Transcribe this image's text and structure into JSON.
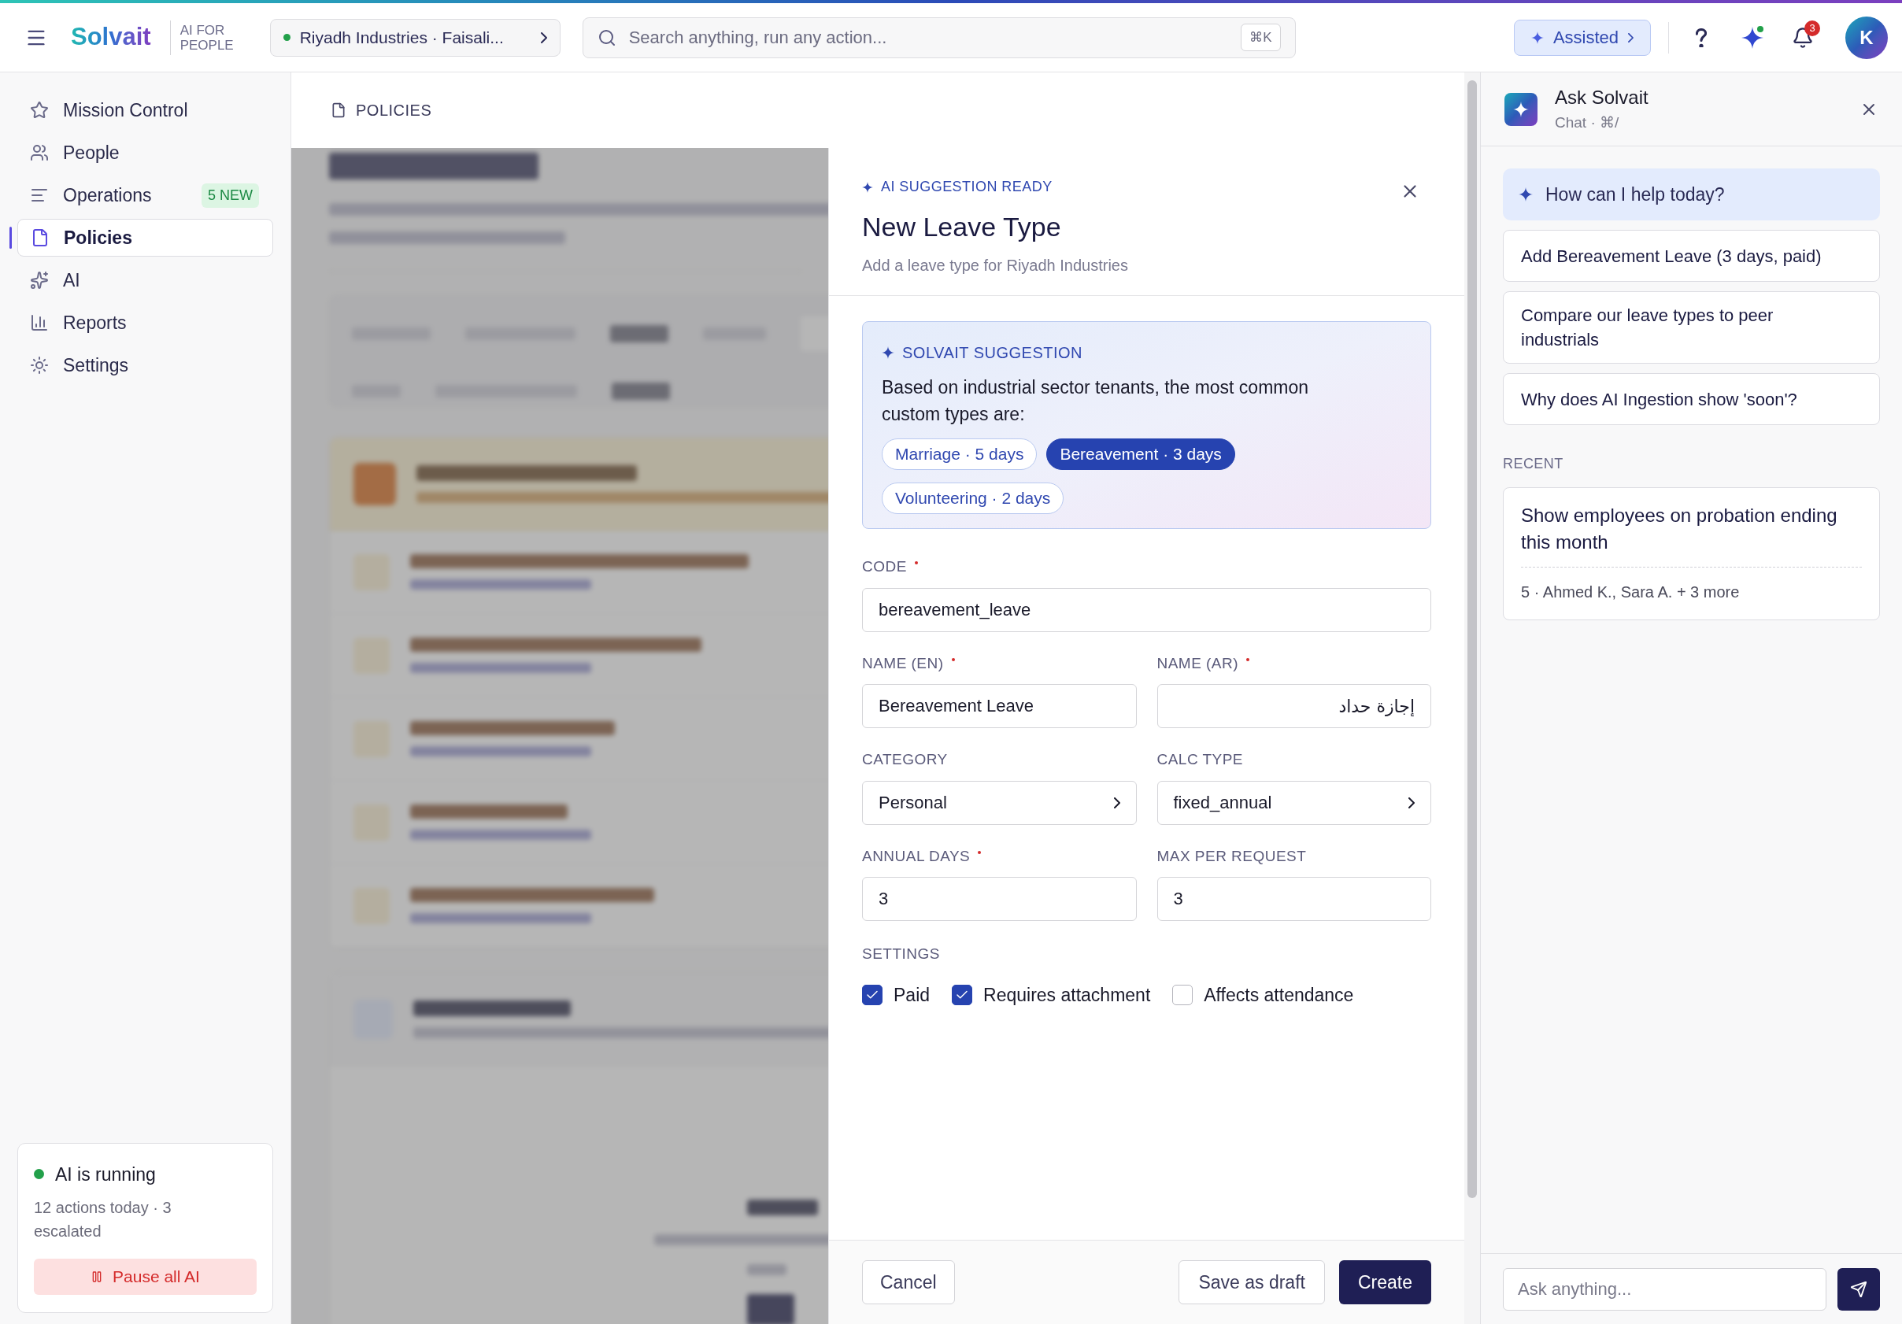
{
  "topbar": {
    "logo": "Solvait",
    "tagline": "AI FOR PEOPLE",
    "tenant": {
      "label": "Riyadh Industries · Faisali...",
      "online": true
    },
    "search": {
      "placeholder": "Search anything, run any action...",
      "shortcut": "⌘K"
    },
    "mode": "Assisted",
    "notifications": "3",
    "avatar": "K"
  },
  "sidebar": {
    "items": [
      {
        "label": "Mission Control",
        "selected": false
      },
      {
        "label": "People",
        "selected": false
      },
      {
        "label": "Operations",
        "selected": false,
        "badge": "5 NEW"
      },
      {
        "label": "Policies",
        "selected": true
      },
      {
        "label": "AI",
        "selected": false
      },
      {
        "label": "Reports",
        "selected": false
      },
      {
        "label": "Settings",
        "selected": false
      }
    ],
    "status": {
      "title": "AI is running",
      "detail": "12 actions today · 3 escalated",
      "button": "Pause all AI"
    }
  },
  "breadcrumb": "POLICIES",
  "drawer": {
    "eyebrow": "AI SUGGESTION READY",
    "title": "New Leave Type",
    "subtitle": "Add a leave type for Riyadh Industries",
    "suggestion": {
      "heading": "SOLVAIT SUGGESTION",
      "text": "Based on industrial sector tenants, the most common custom types are:",
      "chips": [
        {
          "label": "Marriage · 5 days",
          "selected": false
        },
        {
          "label": "Bereavement · 3 days",
          "selected": true
        },
        {
          "label": "Volunteering · 2 days",
          "selected": false
        }
      ]
    },
    "fields": [
      {
        "kind": "text",
        "label": "CODE",
        "required": true,
        "value": "bereavement_leave"
      },
      {
        "kind": "text",
        "label": "NAME (EN)",
        "required": true,
        "value": "Bereavement Leave"
      },
      {
        "kind": "rtl",
        "label": "NAME (AR)",
        "required": true,
        "value": "إجازة حداد"
      },
      {
        "kind": "select",
        "label": "CATEGORY",
        "required": false,
        "value": "Personal"
      },
      {
        "kind": "select",
        "label": "CALC TYPE",
        "required": false,
        "value": "fixed_annual"
      },
      {
        "kind": "text",
        "label": "ANNUAL DAYS",
        "required": true,
        "value": "3"
      },
      {
        "kind": "text",
        "label": "MAX PER REQUEST",
        "required": false,
        "value": "3"
      }
    ],
    "settings_label": "SETTINGS",
    "settings": [
      {
        "label": "Paid",
        "checked": true
      },
      {
        "label": "Requires attachment",
        "checked": true
      },
      {
        "label": "Affects attendance",
        "checked": false
      }
    ],
    "buttons": {
      "cancel": "Cancel",
      "draft": "Save as draft",
      "create": "Create"
    }
  },
  "chat": {
    "title": "Ask Solvait",
    "subtitle": "Chat · ⌘/",
    "greeting": "How can I help today?",
    "suggestions": [
      "Add Bereavement Leave (3 days, paid)",
      "Compare our leave types to peer industrials",
      "Why does AI Ingestion show 'soon'?"
    ],
    "recent_label": "RECENT",
    "recent": [
      {
        "query": "Show employees on probation ending this month",
        "result": "5 · Ahmed K., Sara A. + 3 more"
      }
    ],
    "input_placeholder": "Ask anything..."
  }
}
